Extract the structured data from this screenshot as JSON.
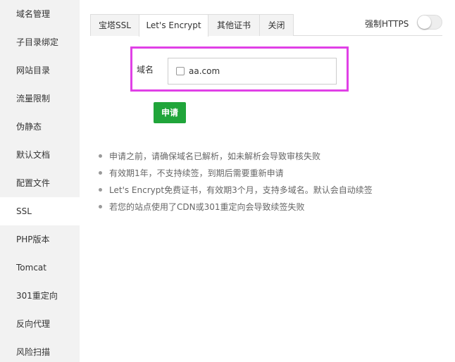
{
  "sidebar": {
    "items": [
      {
        "label": "域名管理"
      },
      {
        "label": "子目录绑定"
      },
      {
        "label": "网站目录"
      },
      {
        "label": "流量限制"
      },
      {
        "label": "伪静态"
      },
      {
        "label": "默认文档"
      },
      {
        "label": "配置文件"
      },
      {
        "label": "SSL"
      },
      {
        "label": "PHP版本"
      },
      {
        "label": "Tomcat"
      },
      {
        "label": "301重定向"
      },
      {
        "label": "反向代理"
      },
      {
        "label": "风险扫描"
      }
    ],
    "active": "SSL"
  },
  "tabs": [
    {
      "label": "宝塔SSL"
    },
    {
      "label": "Let's Encrypt"
    },
    {
      "label": "其他证书"
    },
    {
      "label": "关闭"
    }
  ],
  "active_tab": "Let's Encrypt",
  "force_https": {
    "label": "强制HTTPS",
    "enabled": false
  },
  "domain": {
    "label": "域名",
    "options": [
      {
        "value": "aa.com",
        "checked": false
      }
    ]
  },
  "apply_button": "申请",
  "tips": [
    "申请之前，请确保域名已解析，如未解析会导致审核失败",
    "有效期1年，不支持续签，到期后需要重新申请",
    "Let's Encrypt免费证书，有效期3个月，支持多域名。默认会自动续签",
    "若您的站点使用了CDN或301重定向会导致续签失败"
  ],
  "colors": {
    "accent": "#20a53a",
    "highlight": "#e040e6"
  }
}
